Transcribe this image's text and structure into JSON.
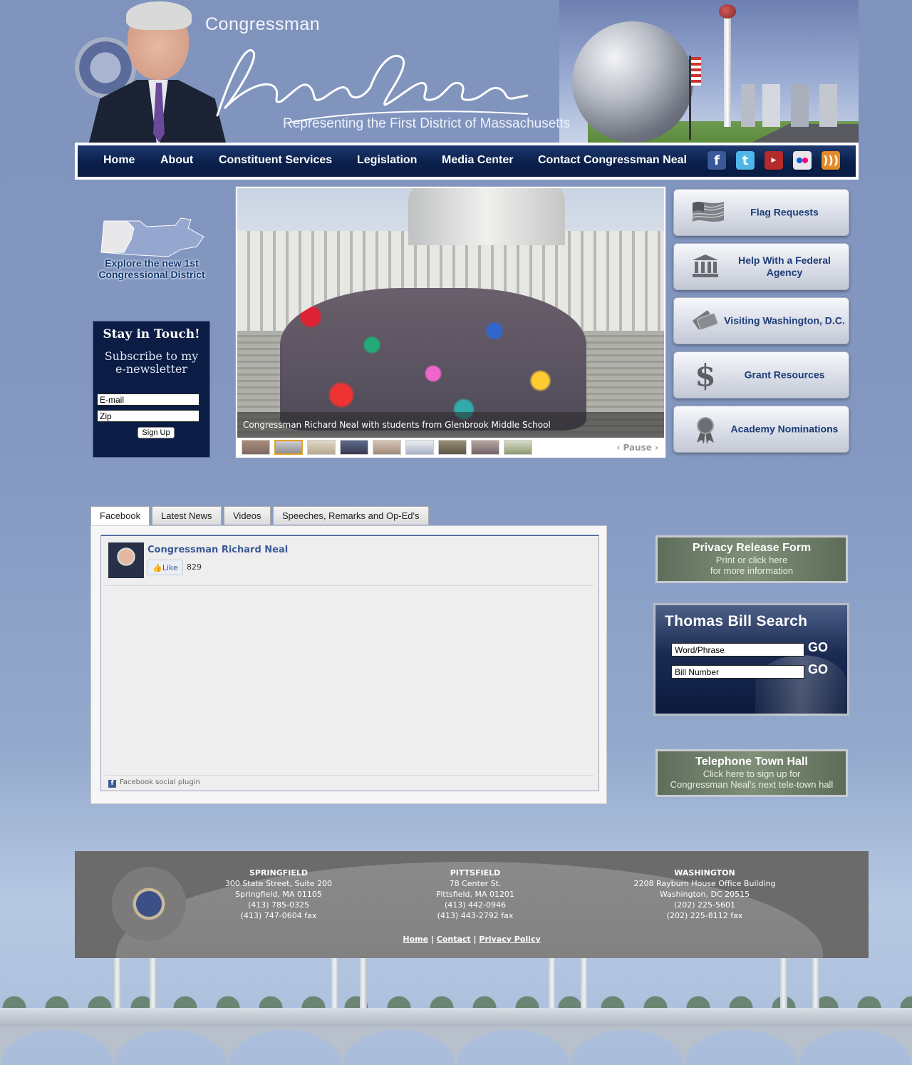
{
  "header": {
    "title_prefix": "Congressman",
    "tagline": "Representing the First District of Massachusetts"
  },
  "nav": {
    "items": [
      "Home",
      "About",
      "Constituent Services",
      "Legislation",
      "Media Center",
      "Contact Congressman Neal"
    ],
    "social": [
      {
        "name": "facebook-icon",
        "color": "#3b5998"
      },
      {
        "name": "twitter-icon",
        "color": "#4fb6e8"
      },
      {
        "name": "youtube-icon",
        "color": "#b52a2a"
      },
      {
        "name": "flickr-icon",
        "color": "#e8e8ec"
      },
      {
        "name": "rss-icon",
        "color": "#e58a2a"
      }
    ]
  },
  "explore": {
    "line1": "Explore the new 1st",
    "line2": "Congressional District"
  },
  "newsletter": {
    "heading": "Stay in Touch!",
    "sub1": "Subscribe to my",
    "sub2": "e-newsletter",
    "email_value": "E-mail",
    "zip_value": "Zip",
    "button": "Sign Up"
  },
  "slideshow": {
    "caption": "Congressman Richard Neal with students from Glenbrook Middle School",
    "pause_label": "‹ Pause ›",
    "thumbnail_count": 9,
    "active_thumbnail": 2
  },
  "right_buttons": [
    {
      "label": "Flag Requests",
      "icon": "flag-icon"
    },
    {
      "label": "Help With a Federal Agency",
      "icon": "building-icon"
    },
    {
      "label": "Visiting Washington, D.C.",
      "icon": "tickets-icon"
    },
    {
      "label": "Grant Resources",
      "icon": "dollar-icon"
    },
    {
      "label": "Academy Nominations",
      "icon": "ribbon-icon"
    }
  ],
  "tabs": [
    "Facebook",
    "Latest News",
    "Videos",
    "Speeches, Remarks and Op-Ed's"
  ],
  "facebook": {
    "page_name": "Congressman Richard Neal",
    "like_label": "Like",
    "like_count": "829",
    "plugin_label": "Facebook social plugin"
  },
  "privacy": {
    "title": "Privacy Release Form",
    "line1": "Print or click here",
    "line2": "for more information"
  },
  "thomas": {
    "title": "Thomas Bill Search",
    "word_value": "Word/Phrase",
    "bill_value": "Bill Number",
    "go_label": "GO"
  },
  "townhall": {
    "title": "Telephone Town Hall",
    "line1": "Click here to sign up for",
    "line2": "Congressman Neal's next tele-town hall"
  },
  "footer": {
    "offices": [
      {
        "name": "SPRINGFIELD",
        "lines": [
          "300 State Street, Suite 200",
          "Springfield, MA 01105",
          "(413) 785-0325",
          "(413) 747-0604 fax"
        ]
      },
      {
        "name": "PITTSFIELD",
        "lines": [
          "78 Center St.",
          "Pittsfield, MA 01201",
          "(413) 442-0946",
          "(413) 443-2792 fax"
        ]
      },
      {
        "name": "WASHINGTON",
        "lines": [
          "2208 Rayburn House Office Building",
          "Washington, DC 20515",
          "(202) 225-5601",
          "(202) 225-8112 fax"
        ]
      }
    ],
    "links": [
      "Home",
      "Contact",
      "Privacy Policy"
    ]
  }
}
